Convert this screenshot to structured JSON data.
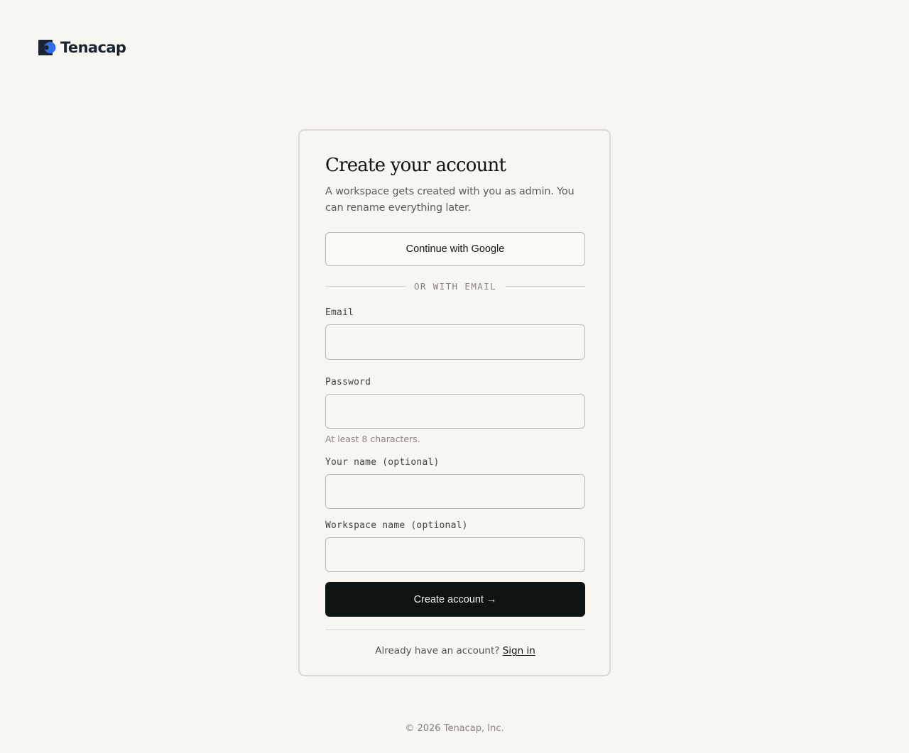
{
  "brand": {
    "name": "Tenacap",
    "logo_icon": "tenacap-logo-icon",
    "colors": {
      "dark": "#1b2330",
      "accent": "#2f6fe6"
    }
  },
  "card": {
    "title": "Create your account",
    "subtitle": "A workspace gets created with you as admin. You can rename everything later.",
    "google_button": "Continue with Google",
    "divider": "OR WITH EMAIL",
    "fields": {
      "email": {
        "label": "Email",
        "value": "",
        "placeholder": ""
      },
      "password": {
        "label": "Password",
        "value": "",
        "placeholder": "",
        "hint": "At least 8 characters."
      },
      "name": {
        "label": "Your name (optional)",
        "value": "",
        "placeholder": ""
      },
      "workspace": {
        "label": "Workspace name (optional)",
        "value": "",
        "placeholder": ""
      }
    },
    "submit": {
      "label": "Create account",
      "arrow": "→",
      "color": "#0e1411"
    },
    "signin": {
      "prompt": "Already have an account?",
      "link": "Sign in"
    }
  },
  "footer": {
    "copyright": "© 2026 Tenacap, Inc."
  }
}
